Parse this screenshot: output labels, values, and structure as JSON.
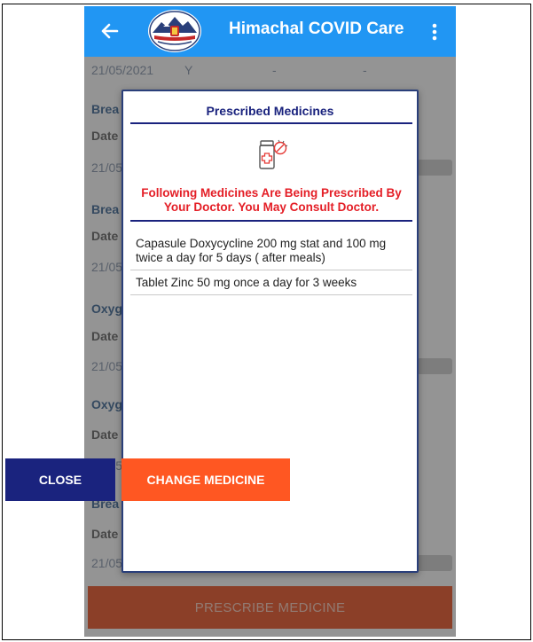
{
  "app": {
    "title": "Himachal COVID Care",
    "accent_color": "#2196F3"
  },
  "background": {
    "top_row": {
      "date": "21/05/2021",
      "flag": "Y",
      "dash1": "-",
      "dash2": "-"
    },
    "section_heads": [
      "Brea",
      "Brea",
      "Oxyg",
      "Oxyg",
      "Brea"
    ],
    "date_labels": [
      "Date",
      "Date",
      "Date",
      "Date",
      "Date"
    ],
    "date_values": [
      "21/05",
      "21/05",
      "21/05",
      "21/05",
      "21/05"
    ],
    "bottom_button_label": "PRESCRIBE MEDICINE"
  },
  "dialog": {
    "title": "Prescribed Medicines",
    "notice": "Following Medicines Are Being Prescribed By Your Doctor. You May Consult Doctor.",
    "medicines": [
      "Capasule Doxycycline 200 mg stat and 100 mg twice a day for 5 days ( after meals)",
      "Tablet Zinc 50 mg  once a day for 3 weeks"
    ],
    "close_label": "CLOSE",
    "change_label": "CHANGE MEDICINE",
    "notice_color": "#E41E26",
    "title_color": "#1A237E",
    "change_color": "#FF5722"
  },
  "icons": {
    "back": "arrow-left-icon",
    "menu": "more-vert-icon",
    "logo": "himachal-emblem-logo",
    "medicine": "medicine-bottle-icon"
  }
}
